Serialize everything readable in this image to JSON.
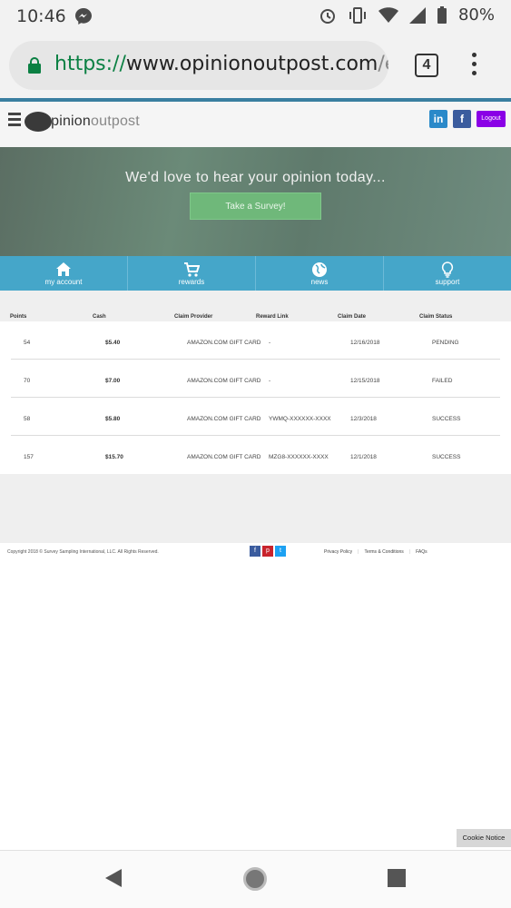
{
  "status_bar": {
    "time": "10:46",
    "battery": "80%"
  },
  "browser": {
    "url_scheme": "https://",
    "url_host": "www.opinionoutpost.com",
    "url_rest": "/en",
    "tab_count": "4"
  },
  "site": {
    "logo_text_1": "opinion",
    "logo_text_2": "outpost",
    "linkedin": "in",
    "facebook": "f",
    "logout_label": "Logout",
    "colors": {
      "accent": "#45a6c9",
      "logout": "#8a00e6",
      "hero_button": "#6fb87a"
    }
  },
  "hero": {
    "title": "We'd love to hear your opinion today...",
    "button": "Take a Survey!"
  },
  "nav": [
    {
      "label": "my account",
      "icon": "home-icon"
    },
    {
      "label": "rewards",
      "icon": "cart-icon"
    },
    {
      "label": "news",
      "icon": "globe-icon"
    },
    {
      "label": "support",
      "icon": "lightbulb-icon"
    }
  ],
  "table": {
    "headers": [
      "Points",
      "Cash",
      "Claim Provider",
      "Reward Link",
      "Claim Date",
      "Claim Status"
    ],
    "rows": [
      {
        "points": "54",
        "cash": "$5.40",
        "provider": "AMAZON.COM GIFT CARD",
        "link": "-",
        "date": "12/16/2018",
        "status": "PENDING"
      },
      {
        "points": "70",
        "cash": "$7.00",
        "provider": "AMAZON.COM GIFT CARD",
        "link": "-",
        "date": "12/15/2018",
        "status": "FAILED"
      },
      {
        "points": "58",
        "cash": "$5.80",
        "provider": "AMAZON.COM GIFT CARD",
        "link": "YWMQ-XXXXXX-XXXX",
        "date": "12/3/2018",
        "status": "SUCCESS"
      },
      {
        "points": "157",
        "cash": "$15.70",
        "provider": "AMAZON.COM GIFT CARD",
        "link": "MZG8-XXXXXX-XXXX",
        "date": "12/1/2018",
        "status": "SUCCESS"
      }
    ]
  },
  "footer": {
    "copyright": "Copyright 2018 © Survey Sampling International, LLC. All Rights Reserved.",
    "privacy": "Privacy Policy",
    "terms": "Terms & Conditions",
    "faqs": "FAQs"
  },
  "cookie_notice": "Cookie Notice"
}
